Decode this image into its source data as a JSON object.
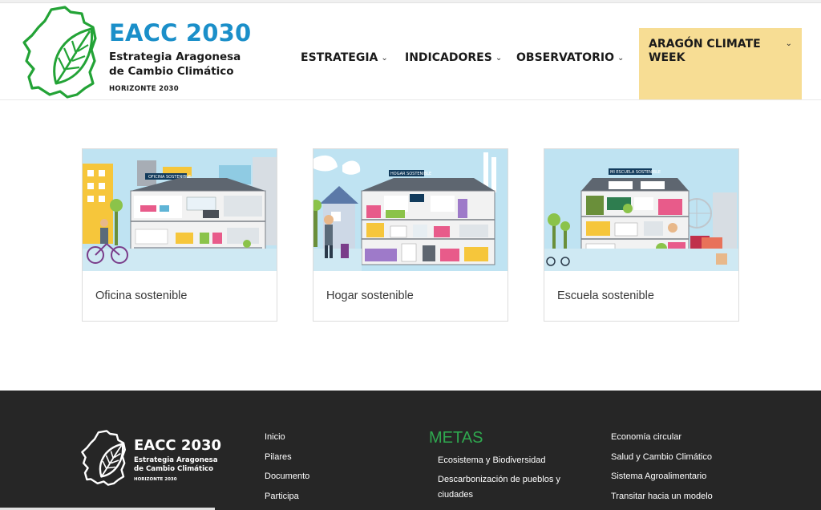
{
  "header": {
    "logo": {
      "title": "EACC 2030",
      "subtitle_line1": "Estrategia Aragonesa",
      "subtitle_line2": "de Cambio Climático",
      "horizon": "HORIZONTE 2030",
      "icon": "aragon-leaf-icon",
      "colors": {
        "title": "#1b8fc9",
        "mark": "#23a336"
      }
    },
    "nav": [
      {
        "label": "ESTRATEGIA",
        "icon": "chevron-down-icon"
      },
      {
        "label": "INDICADORES",
        "icon": "chevron-down-icon"
      },
      {
        "label": "OBSERVATORIO",
        "icon": "chevron-down-icon"
      }
    ],
    "climate_week": {
      "label": "ARAGÓN CLIMATE WEEK",
      "icon": "chevron-down-icon",
      "color": "#f7dd94"
    }
  },
  "cards": [
    {
      "caption": "Oficina sostenible",
      "sign": "OFICINA SOSTENIBLE"
    },
    {
      "caption": "Hogar sostenible",
      "sign": "HOGAR SOSTENIBLE"
    },
    {
      "caption": "Escuela sostenible",
      "sign": "MI ESCUELA SOSTENIBLE"
    }
  ],
  "footer": {
    "logo": {
      "title": "EACC 2030",
      "subtitle_line1": "Estrategia Aragonesa",
      "subtitle_line2": "de Cambio Climático",
      "horizon": "HORIZONTE 2030"
    },
    "links_col1": [
      "Inicio",
      "Pilares",
      "Documento",
      "Participa"
    ],
    "metas_title": "METAS",
    "metas_links": [
      "Ecosistema y Biodiversidad",
      "Descarbonización de pueblos y ciudades"
    ],
    "links_col3": [
      "Economía circular",
      "Salud y Cambio Climático",
      "Sistema Agroalimentario",
      "Transitar hacia un modelo"
    ],
    "colors": {
      "background": "#262626",
      "metas": "#2fa84f"
    }
  }
}
